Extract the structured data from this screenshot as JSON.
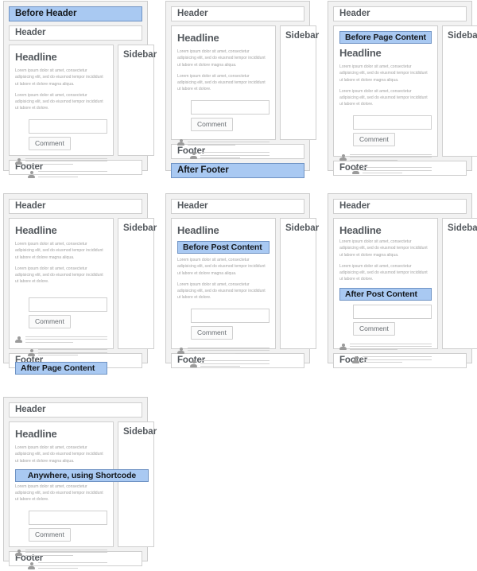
{
  "common": {
    "header_label": "Header",
    "footer_label": "Footer",
    "sidebar_label": "Sidebar",
    "headline_label": "Headline",
    "comment_button_label": "Comment",
    "paragraph_1": "Lorem ipsum dolor sit amet, consectetur adipisicing elit, sed do eiusmod tempor incididunt ut labore et dolore magna aliqua.",
    "paragraph_2": "Lorem ipsum dolor sit amet, consectetur adipisicing elit, sed do eiusmod tempor incididunt ut labore et dolore.",
    "comment_textbox_value": "",
    "comment_textbox_placeholder": ""
  },
  "colors": {
    "highlight_fill": "#a9c9f2",
    "highlight_border": "#6f93c4",
    "panel_background": "#f2f2f2",
    "panel_border": "#cccccc",
    "box_background": "#ffffff",
    "box_border": "#cfcfcf",
    "heading_text": "#555a5f",
    "body_text": "#a2a2a2"
  },
  "panels": [
    {
      "id": "before-header",
      "hook_label": "Before Header"
    },
    {
      "id": "after-footer",
      "hook_label": "After Footer"
    },
    {
      "id": "before-page-content",
      "hook_label": "Before Page Content"
    },
    {
      "id": "after-page-content",
      "hook_label": "After Page Content"
    },
    {
      "id": "before-post-content",
      "hook_label": "Before Post Content"
    },
    {
      "id": "after-post-content",
      "hook_label": "After Post Content"
    },
    {
      "id": "shortcode",
      "hook_label": "Anywhere, using Shortcode"
    }
  ]
}
